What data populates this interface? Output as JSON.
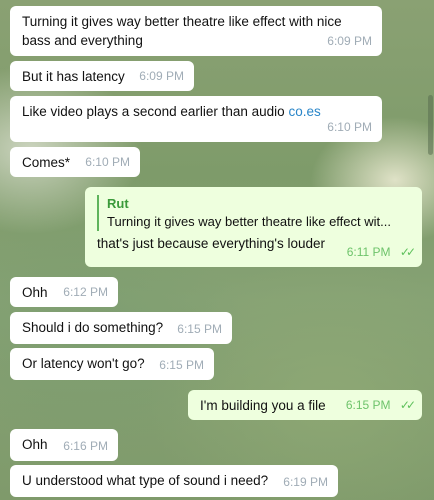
{
  "messages": [
    {
      "text": "Turning it gives way better theatre like effect with nice bass and everything",
      "time": "6:09 PM"
    },
    {
      "text": "But it has latency",
      "time": "6:09 PM"
    },
    {
      "text": "Like video plays a second earlier than audio",
      "link": "co.es",
      "time": "6:10 PM"
    },
    {
      "text": "Comes*",
      "time": "6:10 PM"
    },
    {
      "reply_name": "Rut",
      "reply_text": "Turning it gives way better theatre like effect wit...",
      "text": "that's just because everything's louder",
      "time": "6:11 PM",
      "status": "read-checks-icon"
    },
    {
      "text": "Ohh",
      "time": "6:12 PM"
    },
    {
      "text": "Should i do something?",
      "time": "6:15 PM"
    },
    {
      "text": "Or latency won't go?",
      "time": "6:15 PM"
    },
    {
      "text": "I'm building you a file",
      "time": "6:15 PM",
      "status": "read-checks-icon"
    },
    {
      "text": "Ohh",
      "time": "6:16 PM"
    },
    {
      "text": "U understood what type of sound i need?",
      "time": "6:19 PM"
    }
  ],
  "colors": {
    "incoming": "#ffffff",
    "outgoing": "#eeffde",
    "time": "#a0acb6",
    "check": "#5fc15c",
    "link": "#2a86c9"
  }
}
